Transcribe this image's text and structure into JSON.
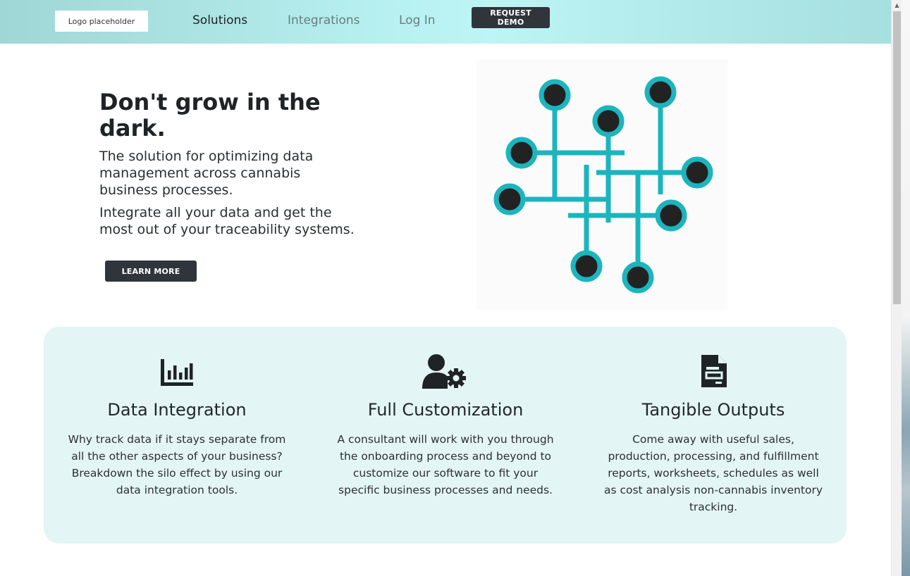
{
  "header": {
    "logo_text": "Logo placeholder",
    "nav": {
      "solutions": "Solutions",
      "integrations": "Integrations",
      "login": "Log In"
    },
    "demo_button": "REQUEST DEMO"
  },
  "hero": {
    "title": "Don't grow in the dark.",
    "subtitle_1": "The solution for optimizing data management across cannabis business processes.",
    "subtitle_2": "Integrate all your data and get the most out of your traceability systems.",
    "cta_button": "LEARN MORE"
  },
  "features": [
    {
      "icon": "bar-chart-icon",
      "title": "Data Integration",
      "text": "Why track data if it stays separate from all the other aspects of your business? Breakdown the silo effect by using our data integration tools."
    },
    {
      "icon": "user-gear-icon",
      "title": "Full Customization",
      "text": "A consultant will work with you through the onboarding process and beyond to customize our software to fit your specific business processes and needs."
    },
    {
      "icon": "document-icon",
      "title": "Tangible Outputs",
      "text": "Come away with useful sales, production, processing, and fulfillment reports, worksheets, schedules as well as cost analysis non-cannabis inventory tracking."
    }
  ],
  "colors": {
    "accent": "#1cb5be",
    "dark_button": "#30343b",
    "card_bg": "#e3f5f5",
    "header_gradient_mid": "#bdf4f5"
  }
}
